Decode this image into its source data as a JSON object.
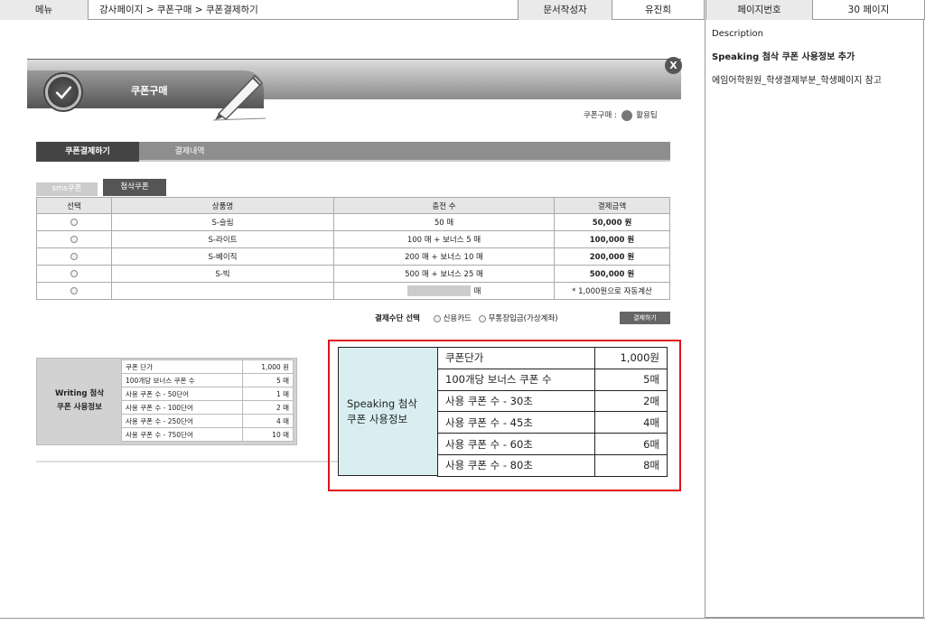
{
  "header": {
    "menu_label": "메뉴",
    "menu_path": "강사페이지 > 쿠폰구매 > 쿠폰결제하기",
    "author_label": "문서작성자",
    "author_name": "유진희",
    "page_label": "페이지번호",
    "page_value": "30 페이지"
  },
  "description": {
    "title": "Description",
    "line1": "Speaking 첨삭 쿠폰 사용정보 추가",
    "line2": "에임어학원원_학생결제부분_학생페이지 참고"
  },
  "popup": {
    "title": "쿠폰구매",
    "close_label": "X",
    "usage_prefix": "쿠폰구매 :",
    "usage_link": "활용팁"
  },
  "tabs": {
    "pay": "쿠폰결제하기",
    "history": "결제내역"
  },
  "subtabs": {
    "sms": "sms쿠폰",
    "correction": "첨삭쿠폰"
  },
  "product_table": {
    "headers": [
      "선택",
      "상품명",
      "충전 수",
      "결제금액"
    ],
    "rows": [
      {
        "name": "S-슬림",
        "count": "50 매",
        "amount": "50,000 원"
      },
      {
        "name": "S-라이트",
        "count": "100 매 + 보너스 5 매",
        "amount": "100,000 원"
      },
      {
        "name": "S-베이직",
        "count": "200 매 + 보너스 10 매",
        "amount": "200,000 원"
      },
      {
        "name": "S-빅",
        "count": "500 매 + 보너스 25 매",
        "amount": "500,000 원"
      }
    ],
    "custom_unit": "매",
    "custom_note": "* 1,000원으로 자동계산"
  },
  "payment": {
    "label": "결제수단 선택",
    "card": "신용카드",
    "bank": "무통장입금(가상계좌)",
    "button": "결제하기"
  },
  "writing_info": {
    "label_line1": "Writing 첨삭",
    "label_line2": "쿠폰 사용정보",
    "rows": [
      {
        "k": "쿠폰 단가",
        "v": "1,000 원"
      },
      {
        "k": "100개당 보너스 쿠폰 수",
        "v": "5 매"
      },
      {
        "k": "사용 쿠폰 수 - 50단어",
        "v": "1 매"
      },
      {
        "k": "사용 쿠폰 수 - 100단어",
        "v": "2 매"
      },
      {
        "k": "사용 쿠폰 수 - 250단어",
        "v": "4 매"
      },
      {
        "k": "사용 쿠폰 수 - 750단어",
        "v": "10 매"
      }
    ]
  },
  "speaking_info": {
    "label_line1": "Speaking 첨삭",
    "label_line2": "쿠폰 사용정보",
    "rows": [
      {
        "k": "쿠폰단가",
        "v": "1,000원"
      },
      {
        "k": "100개당 보너스 쿠폰 수",
        "v": "5매"
      },
      {
        "k": "사용 쿠폰 수 - 30초",
        "v": "2매"
      },
      {
        "k": "사용 쿠폰 수 - 45초",
        "v": "4매"
      },
      {
        "k": "사용 쿠폰 수 - 60초",
        "v": "6매"
      },
      {
        "k": "사용 쿠폰 수 - 80초",
        "v": "8매"
      }
    ]
  },
  "colors": {
    "highlight_border": "#e0141a",
    "speaking_label_bg": "#d9eef1",
    "tab_active": "#444444"
  }
}
